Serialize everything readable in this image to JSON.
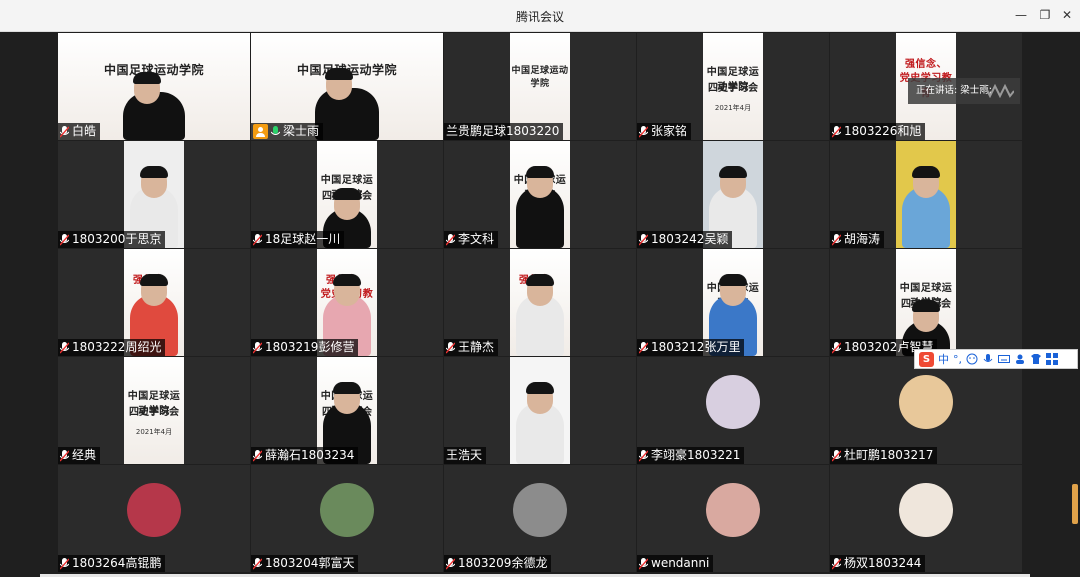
{
  "window": {
    "title": "腾讯会议",
    "controls": {
      "minimize": "—",
      "restore": "❐",
      "close": "✕"
    }
  },
  "speaking_indicator": {
    "text": "正在讲话: 梁士雨;"
  },
  "ime_toolbar": {
    "mode": "中",
    "punct": "°,"
  },
  "banners": {
    "school_short": "中国足球运动学院",
    "session": "四史学习会",
    "slogan": "强信念、",
    "slogan2": "党史学习教育",
    "date": "2021年4月"
  },
  "participants": [
    {
      "name": "白皓"
    },
    {
      "name": "梁士雨",
      "host": true,
      "speaking": true
    },
    {
      "name": "兰贵鹏足球1803220"
    },
    {
      "name": "张家铭"
    },
    {
      "name": "1803226和旭"
    },
    {
      "name": "1803200于思京"
    },
    {
      "name": "18足球赵一川"
    },
    {
      "name": "李文科"
    },
    {
      "name": "1803242吴颖"
    },
    {
      "name": "胡海涛"
    },
    {
      "name": "1803222周绍光"
    },
    {
      "name": "1803219彭修营"
    },
    {
      "name": "王静杰"
    },
    {
      "name": "1803212张万里"
    },
    {
      "name": "1803202卢智慧"
    },
    {
      "name": "经典"
    },
    {
      "name": "薛瀚石1803234"
    },
    {
      "name": "王浩天"
    },
    {
      "name": "李翊豪1803221"
    },
    {
      "name": "杜町鹏1803217"
    },
    {
      "name": "1803264高锟鹏"
    },
    {
      "name": "1803204郭富天"
    },
    {
      "name": "1803209余德龙"
    },
    {
      "name": "wendanni"
    },
    {
      "name": "杨双1803244"
    }
  ]
}
